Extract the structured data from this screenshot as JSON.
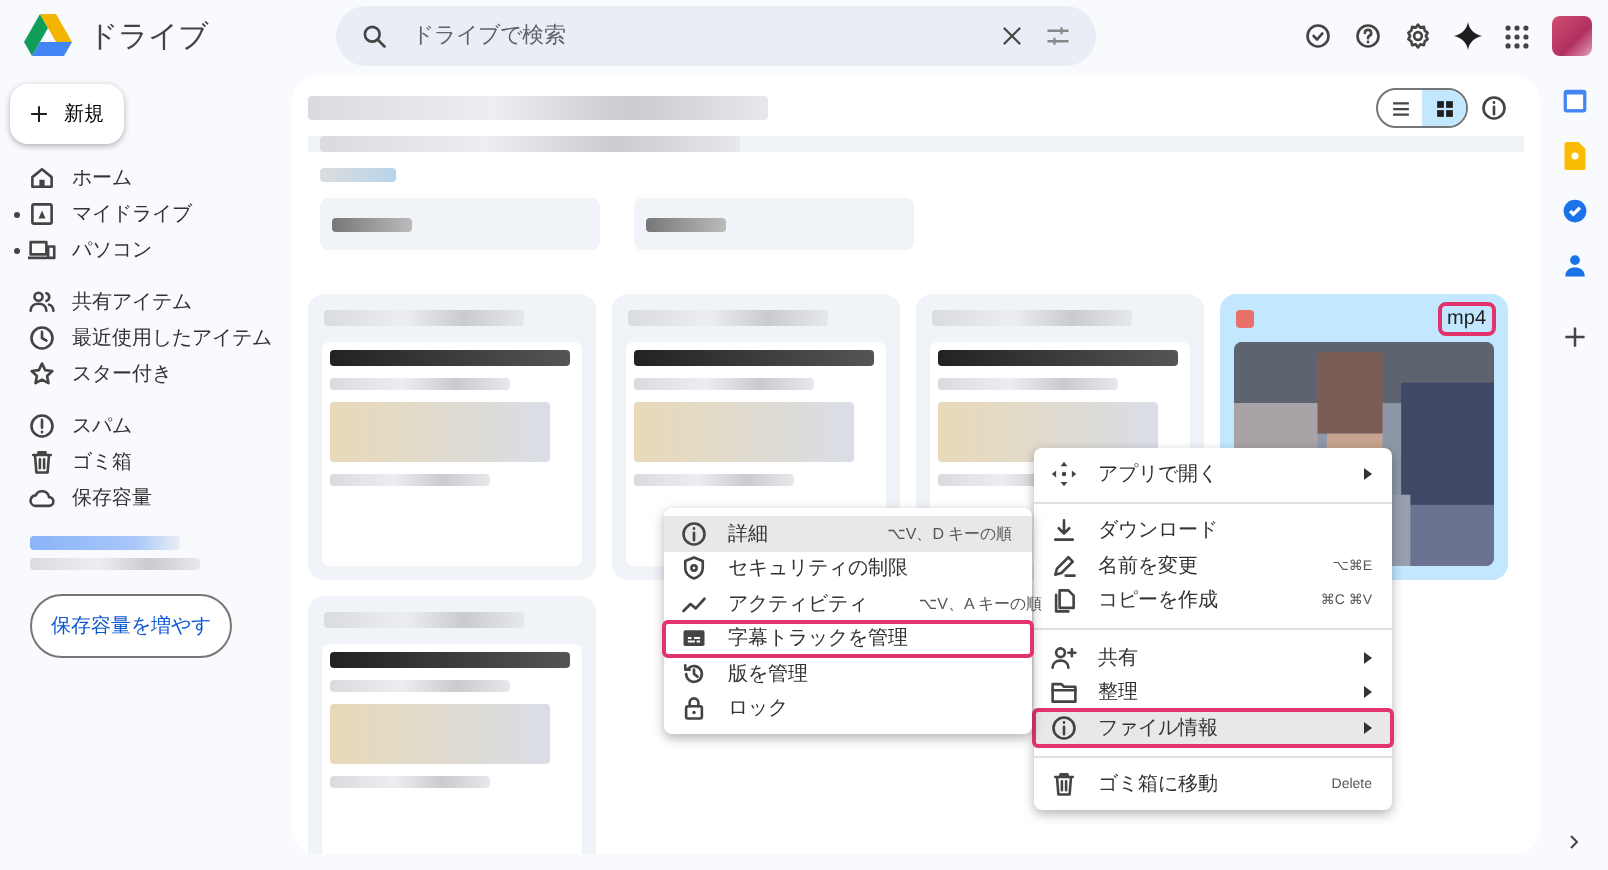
{
  "app": {
    "title": "ドライブ"
  },
  "search": {
    "placeholder": "ドライブで検索"
  },
  "new_button": "新規",
  "sidebar": {
    "groups": [
      [
        {
          "label": "ホーム",
          "expandable": false,
          "selected": false
        },
        {
          "label": "マイドライブ",
          "expandable": true,
          "selected": false
        },
        {
          "label": "パソコン",
          "expandable": true,
          "selected": false
        }
      ],
      [
        {
          "label": "共有アイテム",
          "expandable": false,
          "selected": false
        },
        {
          "label": "最近使用したアイテム",
          "expandable": false,
          "selected": false
        },
        {
          "label": "スター付き",
          "expandable": false,
          "selected": false
        }
      ],
      [
        {
          "label": "スパム",
          "expandable": false,
          "selected": false
        },
        {
          "label": "ゴミ箱",
          "expandable": false,
          "selected": false
        },
        {
          "label": "保存容量",
          "expandable": false,
          "selected": false
        }
      ]
    ]
  },
  "storage_button": "保存容量を増やす",
  "view_toggle": [
    {
      "selected": false
    },
    {
      "selected": true
    }
  ],
  "files": [
    {
      "kind": "blurred",
      "selected": false
    },
    {
      "kind": "blurred",
      "selected": false
    },
    {
      "kind": "blurred",
      "selected": false
    },
    {
      "kind": "video",
      "label": "mp4",
      "selected": true,
      "highlighted": true
    },
    {
      "kind": "blurred",
      "selected": false
    }
  ],
  "context_menu": {
    "groups": [
      [
        {
          "label": "アプリで開く",
          "submenu": true,
          "selected": false,
          "highlighted": false
        }
      ],
      [
        {
          "label": "ダウンロード",
          "submenu": false,
          "selected": false,
          "highlighted": false
        },
        {
          "label": "名前を変更",
          "shortcut": "⌥⌘E",
          "submenu": false,
          "selected": false,
          "highlighted": false
        },
        {
          "label": "コピーを作成",
          "shortcut": "⌘C ⌘V",
          "submenu": false,
          "selected": false,
          "highlighted": false
        }
      ],
      [
        {
          "label": "共有",
          "submenu": true,
          "selected": false,
          "highlighted": false
        },
        {
          "label": "整理",
          "submenu": true,
          "selected": false,
          "highlighted": false
        },
        {
          "label": "ファイル情報",
          "submenu": true,
          "selected": true,
          "highlighted": true
        }
      ],
      [
        {
          "label": "ゴミ箱に移動",
          "shortcut": "Delete",
          "submenu": false,
          "selected": false,
          "highlighted": false
        }
      ]
    ]
  },
  "submenu": {
    "items": [
      {
        "label": "詳細",
        "shortcut": "⌥V、D キーの順",
        "selected": true,
        "highlighted": false
      },
      {
        "label": "セキュリティの制限",
        "selected": false,
        "highlighted": false
      },
      {
        "label": "アクティビティ",
        "shortcut": "⌥V、A キーの順",
        "selected": false,
        "highlighted": false
      },
      {
        "label": "字幕トラックを管理",
        "selected": false,
        "highlighted": true
      },
      {
        "label": "版を管理",
        "selected": false,
        "highlighted": false
      },
      {
        "label": "ロック",
        "selected": false,
        "highlighted": false
      }
    ]
  }
}
